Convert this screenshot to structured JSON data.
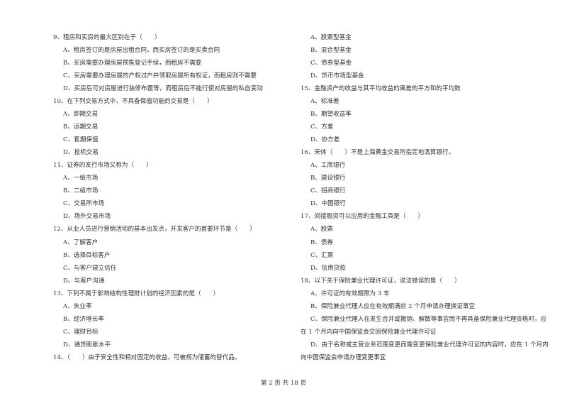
{
  "left_column": [
    {
      "type": "q",
      "text": "9、租房和买房的最大区别在于（　　）"
    },
    {
      "type": "o",
      "text": "A、租房签订的是房屋出租合同，而买房签订的是买卖合同"
    },
    {
      "type": "o",
      "text": "B、买房需要办理房屋预售登记手续，而租房不需要"
    },
    {
      "type": "o",
      "text": "C、买房需要办理房屋的产权过户并领取房屋所有权证，而租房则不需要"
    },
    {
      "type": "o",
      "text": "D、买房后可对房屋进行装修布置等，而租房后不能行使对房屋的私自变动"
    },
    {
      "type": "q",
      "text": "10、在下列交易方式中，不具备保值功能的交易是（　　）"
    },
    {
      "type": "o",
      "text": "A、即期交易"
    },
    {
      "type": "o",
      "text": "B、远期交易"
    },
    {
      "type": "o",
      "text": "C、套期保值"
    },
    {
      "type": "o",
      "text": "D、投机交易"
    },
    {
      "type": "q",
      "text": "11、证券的发行市场又称为（　　）"
    },
    {
      "type": "o",
      "text": "A、一级市场"
    },
    {
      "type": "o",
      "text": "B、二级市场"
    },
    {
      "type": "o",
      "text": "C、交易所市场"
    },
    {
      "type": "o",
      "text": "D、场外交易市场"
    },
    {
      "type": "q",
      "text": "12、从业人员进行营销活动的基本出发点，开发客户的首要环节是（　　）"
    },
    {
      "type": "o",
      "text": "A、了解客户"
    },
    {
      "type": "o",
      "text": "B、选择目标客户"
    },
    {
      "type": "o",
      "text": "C、与客户建立信任"
    },
    {
      "type": "o",
      "text": "D、与客户沟通"
    },
    {
      "type": "q",
      "text": "13、下列不属于影响结构性理财计划的经济因素的是（　　）"
    },
    {
      "type": "o",
      "text": "A、失业率"
    },
    {
      "type": "o",
      "text": "B、经济增长率"
    },
    {
      "type": "o",
      "text": "C、理财目标"
    },
    {
      "type": "o",
      "text": "D、通货膨胀水平"
    },
    {
      "type": "q",
      "text": "14、（　　）由于安全性和相对固定的收益，可被视为储蓄的替代品。"
    }
  ],
  "right_column": [
    {
      "type": "o",
      "text": "A、股票型基金"
    },
    {
      "type": "o",
      "text": "B、混合型基金"
    },
    {
      "type": "o",
      "text": "C、债券型基金"
    },
    {
      "type": "o",
      "text": "D、货币市场型基金"
    },
    {
      "type": "q",
      "text": "15、金融资产的收益与其平均收益的离差的平方和的平均数"
    },
    {
      "type": "o",
      "text": "A、标准差"
    },
    {
      "type": "o",
      "text": "B、期望收益率"
    },
    {
      "type": "o",
      "text": "C、方差"
    },
    {
      "type": "o",
      "text": "D、协方差"
    },
    {
      "type": "q",
      "text": "16、宋体（　　）不是上海黄金交易所指定地清算银行。"
    },
    {
      "type": "o",
      "text": "A、工商银行"
    },
    {
      "type": "o",
      "text": "B、建设银行"
    },
    {
      "type": "o",
      "text": "C、招商银行"
    },
    {
      "type": "o",
      "text": "D、中国银行"
    },
    {
      "type": "q",
      "text": "17、间接融资可以应用的金融工具是（　　）"
    },
    {
      "type": "o",
      "text": "A、股票"
    },
    {
      "type": "o",
      "text": "B、债券"
    },
    {
      "type": "o",
      "text": "C、汇票"
    },
    {
      "type": "o",
      "text": "D、信用贷款"
    },
    {
      "type": "q",
      "text": "18、以下关于保险兼业代理许可证，说法错误的是（　　）"
    },
    {
      "type": "o",
      "text": "A、许可证的有效期限为 3 年"
    },
    {
      "type": "o",
      "text": "B、保险兼业代理人应在有效期满前 2 个月申请办理换证事宜"
    },
    {
      "type": "o",
      "text": "C、保险兼业代理人在发生合并或撤销、解散等事宜而不再具备保险兼业代理资格时，应"
    },
    {
      "type": "q",
      "text": "在 1 个月内向中国保监会交回保险兼业代理许可证"
    },
    {
      "type": "o",
      "text": "D、由于名称或主营业务范围变更而需变更保险兼业代理许可证的内容时，应在 1 个月内"
    },
    {
      "type": "q",
      "text": "向中国保监会申请办理变更事宜"
    }
  ],
  "footer": {
    "page_label": "第 2 页 共 18 页"
  }
}
